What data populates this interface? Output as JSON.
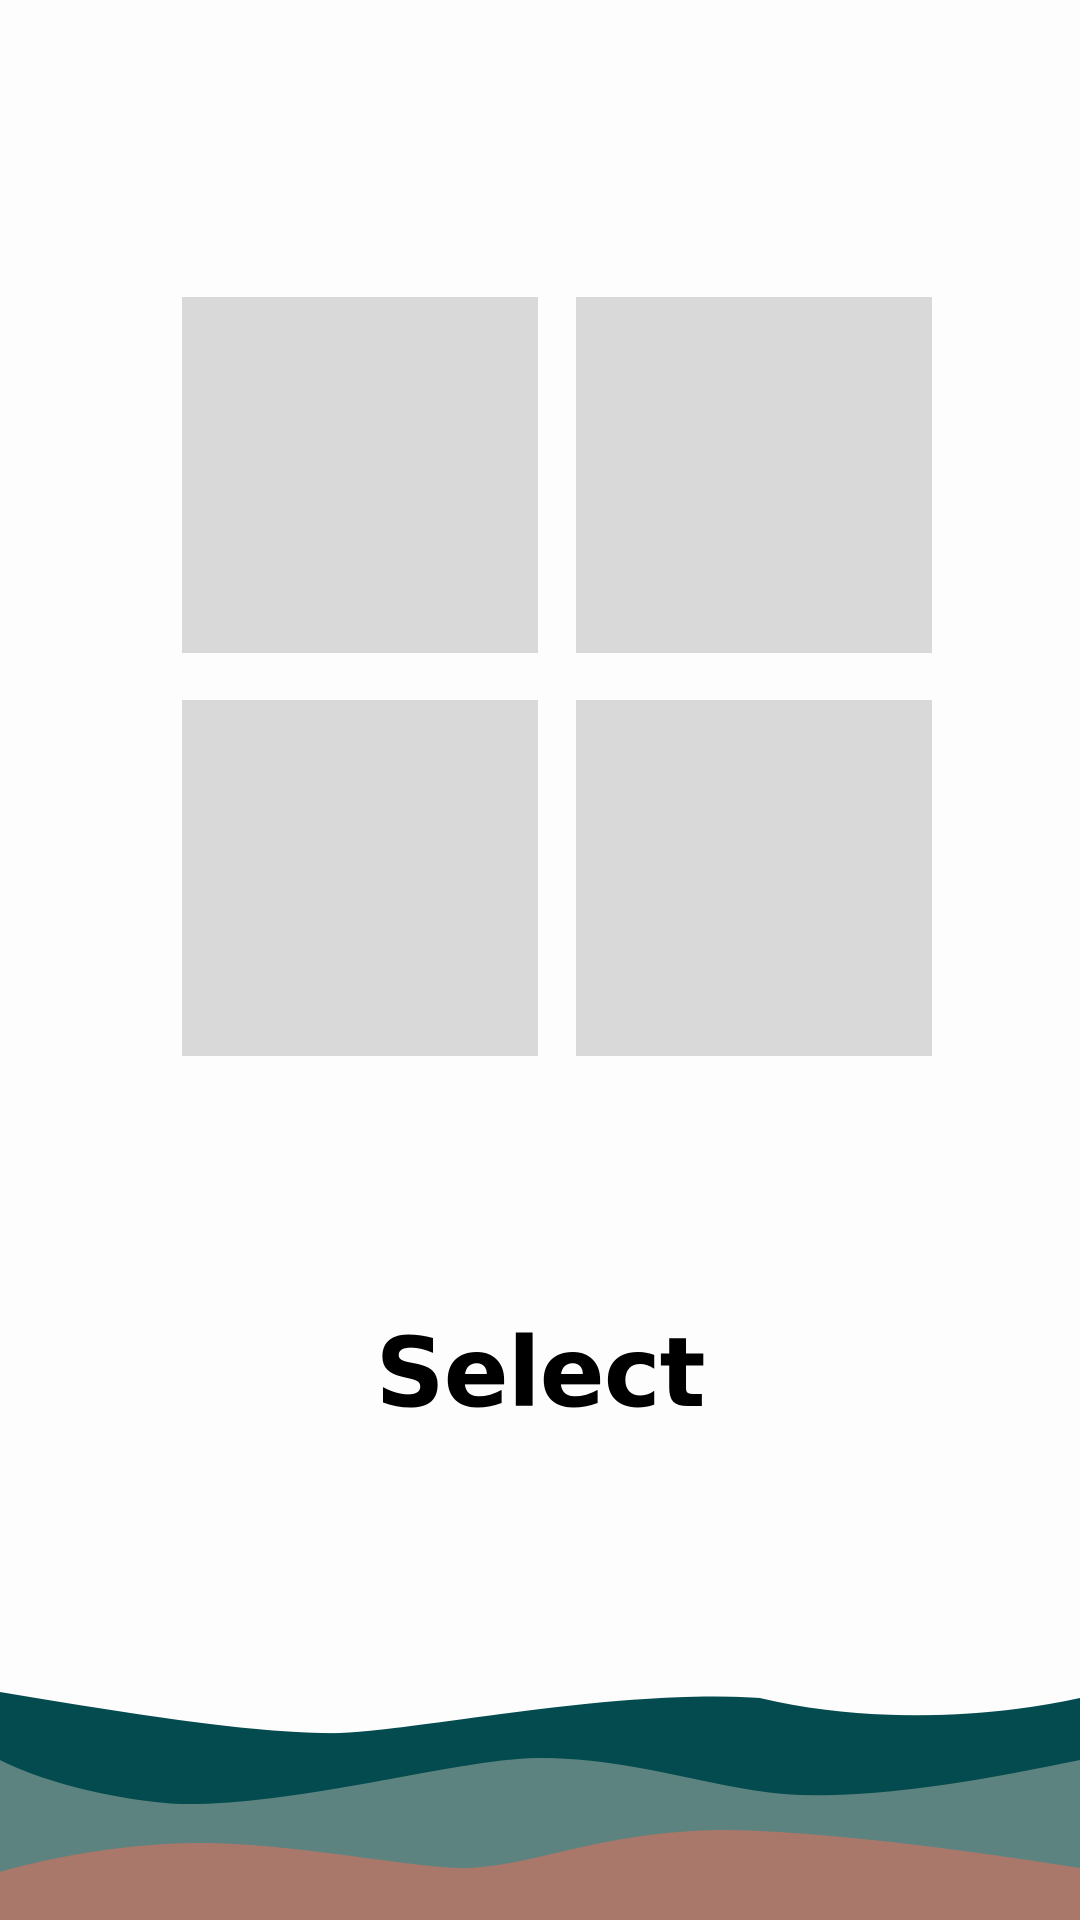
{
  "screen": {
    "title": "Select"
  },
  "grid": {
    "tiles": [
      {
        "id": "tile-1"
      },
      {
        "id": "tile-2"
      },
      {
        "id": "tile-3"
      },
      {
        "id": "tile-4"
      }
    ]
  },
  "colors": {
    "background": "#fdfdfd",
    "tile": "#d9d9d9",
    "wave_dark_teal": "#034b4f",
    "wave_muted_teal": "#5c837f",
    "wave_terracotta": "#a9786a",
    "title_text": "#000000"
  }
}
